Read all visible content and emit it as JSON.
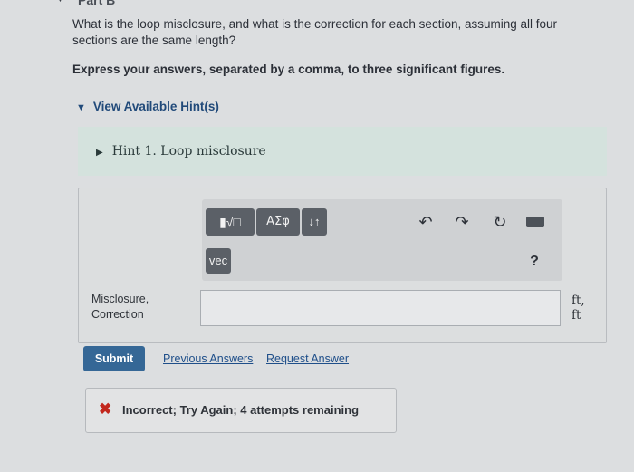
{
  "part": {
    "label": "Part B"
  },
  "question": {
    "text": "What is the loop misclosure, and what is the correction for each section, assuming all four sections are the same length?",
    "instruction": "Express your answers, separated by a comma, to three significant figures."
  },
  "hints": {
    "toggle_label": "View Available Hint(s)",
    "items": [
      {
        "label": "Hint 1. Loop misclosure"
      }
    ]
  },
  "toolbar": {
    "templates_label": "▮√□",
    "greek_label": "ΑΣφ",
    "arrows_label": "↓↑",
    "vec_label": "vec",
    "undo_icon": "↶",
    "redo_icon": "↷",
    "reset_icon": "↻",
    "help_label": "?"
  },
  "answer": {
    "label_line1": "Misclosure,",
    "label_line2": "Correction",
    "value": "",
    "unit_line1": "ft,",
    "unit_line2": "ft"
  },
  "actions": {
    "submit_label": "Submit",
    "previous_answers_label": "Previous Answers",
    "request_answer_label": "Request Answer"
  },
  "feedback": {
    "icon": "✖",
    "message": "Incorrect; Try Again; 4 attempts remaining"
  }
}
